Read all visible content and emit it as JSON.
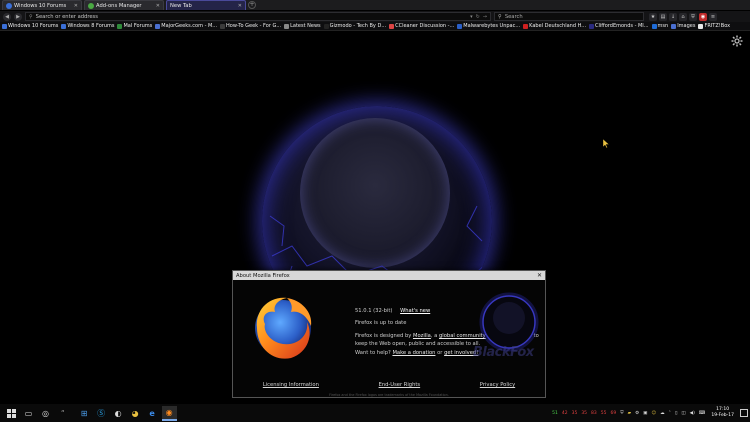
{
  "tabs": [
    {
      "label": "Windows 10 Forums",
      "active": false,
      "icon_color": "#3a6fd8"
    },
    {
      "label": "Add-ons Manager",
      "active": false,
      "icon_color": "#4aa843"
    },
    {
      "label": "New Tab",
      "active": true,
      "icon_color": "#000000"
    }
  ],
  "navbar": {
    "url_placeholder": "Search or enter address",
    "search_placeholder": "Search"
  },
  "bookmarks": [
    {
      "label": "Windows 10 Forums"
    },
    {
      "label": "Windows 8 Forums"
    },
    {
      "label": "Mal Forums"
    },
    {
      "label": "MajorGeeks.com - M..."
    },
    {
      "label": "How-To Geek - For G..."
    },
    {
      "label": "Latest News"
    },
    {
      "label": "Gizmodo - Tech By D..."
    },
    {
      "label": "CCleaner Discussion -..."
    },
    {
      "label": "Malwarebytes Unpac..."
    },
    {
      "label": "Kabel Deutschland H..."
    },
    {
      "label": "CliffordEmonds - MI..."
    },
    {
      "label": "msn"
    },
    {
      "label": "Images"
    },
    {
      "label": "FRITZ!Box"
    }
  ],
  "dialog": {
    "title": "About Mozilla Firefox",
    "version": "51.0.1 (32-bit)",
    "whats_new": "What's new",
    "status": "Firefox is up to date",
    "desc_prefix": "Firefox is designed by",
    "desc_mozilla": "Mozilla",
    "desc_a": ", a",
    "desc_community": "global community",
    "desc_rest": "working together to keep the Web open, public and accessible to all.",
    "help_prefix": "Want to help?",
    "help_donation": "Make a donation",
    "help_or": "or",
    "help_involved": "get involved!",
    "links": [
      "Licensing Information",
      "End-User Rights",
      "Privacy Policy"
    ],
    "trademark": "Firefox and the Firefox logos are trademarks of the Mozilla Foundation.",
    "brand_text": "BlackFox"
  },
  "taskbar": {
    "time": "17:10",
    "date": "19-Feb-17",
    "tray": [
      "51",
      "42",
      "35",
      "35",
      "83",
      "55",
      "69"
    ]
  },
  "colors": {
    "accent_blue": "#4a4ae0",
    "taskbar_active": "#7aa7e6"
  }
}
